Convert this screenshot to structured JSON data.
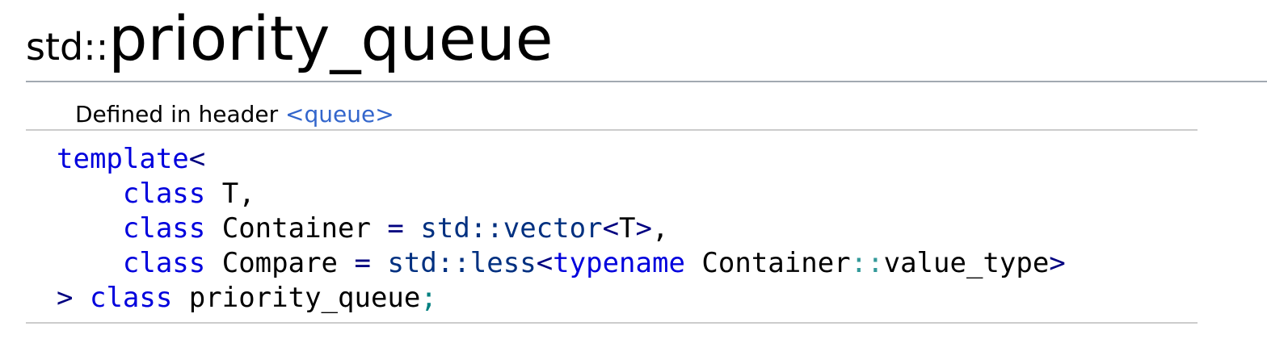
{
  "title": {
    "namespace": "std::",
    "name": "priority_queue"
  },
  "header": {
    "prefix": "Defined in header ",
    "link": "<queue>"
  },
  "code": {
    "l1_kw": "template",
    "l1_op": "<",
    "l2_kw": "class",
    "l2_rest": " T,",
    "l3_kw": "class",
    "l3_name": " Container ",
    "l3_eq": "=",
    "l3_type": "std::vector",
    "l3_lt": "<",
    "l3_t": "T",
    "l3_gt": ">",
    "l3_comma": ",",
    "l4_kw": "class",
    "l4_name": " Compare ",
    "l4_eq": "=",
    "l4_type": "std::less",
    "l4_lt": "<",
    "l4_kw2": "typename",
    "l4_cont": " Container",
    "l4_scope": "::",
    "l4_vt": "value_type",
    "l4_gt": ">",
    "l5_gt": ">",
    "l5_kw": "class",
    "l5_name": " priority_queue",
    "l5_semi": ";"
  },
  "colors": {
    "keyword": "#0000dd",
    "type": "#003080",
    "operator": "#000080",
    "link": "#3366cc"
  }
}
